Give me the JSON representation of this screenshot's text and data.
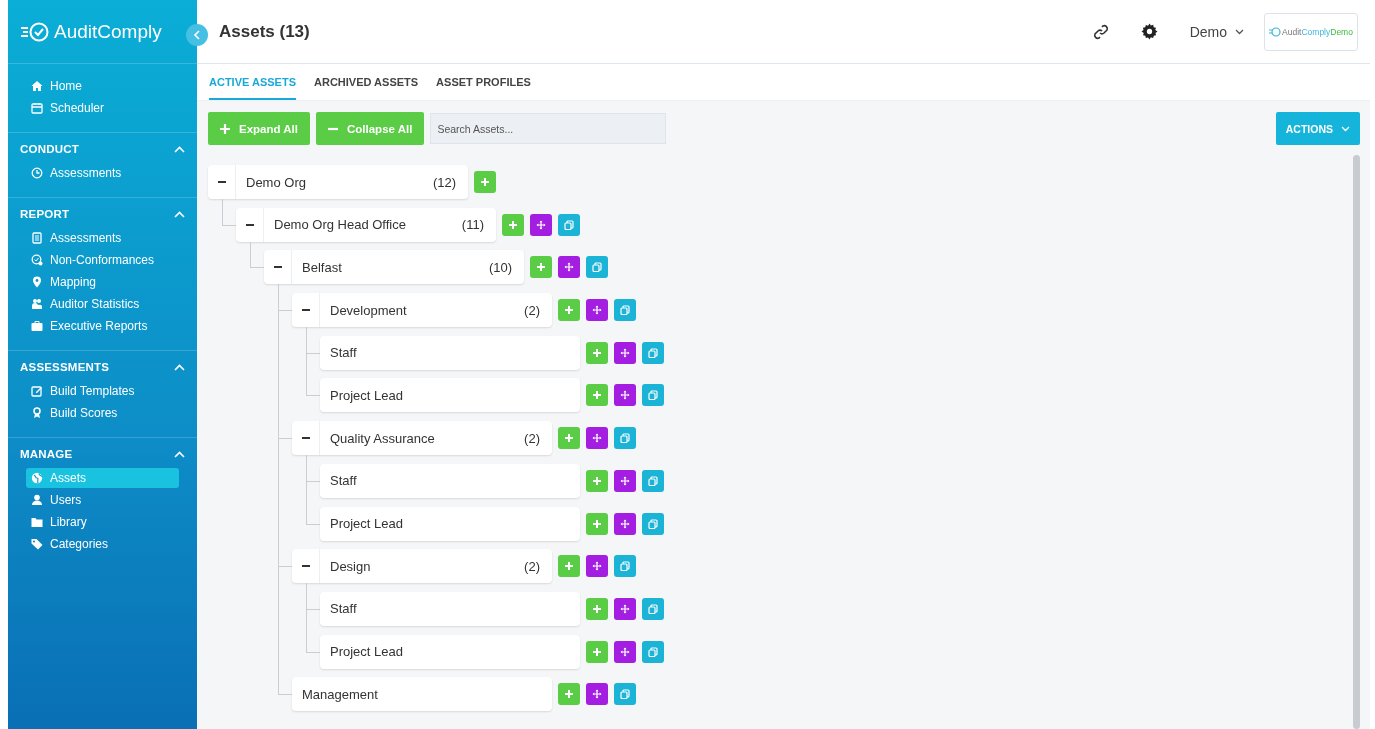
{
  "sidebar": {
    "logo": "AuditComply",
    "top_items": [
      {
        "label": "Home",
        "selected": false
      },
      {
        "label": "Scheduler",
        "selected": false
      }
    ],
    "sections": [
      {
        "title": "CONDUCT",
        "expanded": true,
        "items": [
          {
            "label": "Assessments",
            "selected": false
          }
        ]
      },
      {
        "title": "REPORT",
        "expanded": true,
        "items": [
          {
            "label": "Assessments",
            "selected": false
          },
          {
            "label": "Non-Conformances",
            "selected": false
          },
          {
            "label": "Mapping",
            "selected": false
          },
          {
            "label": "Auditor Statistics",
            "selected": false
          },
          {
            "label": "Executive Reports",
            "selected": false
          }
        ]
      },
      {
        "title": "ASSESSMENTS",
        "expanded": true,
        "items": [
          {
            "label": "Build Templates",
            "selected": false
          },
          {
            "label": "Build Scores",
            "selected": false
          }
        ]
      },
      {
        "title": "MANAGE",
        "expanded": true,
        "items": [
          {
            "label": "Assets",
            "selected": true
          },
          {
            "label": "Users",
            "selected": false
          },
          {
            "label": "Library",
            "selected": false
          },
          {
            "label": "Categories",
            "selected": false
          }
        ]
      }
    ]
  },
  "header": {
    "title": "Assets (13)",
    "user": "Demo",
    "company_logo": [
      "Audit",
      "Comply",
      "Demo"
    ]
  },
  "tabs": [
    {
      "label": "ACTIVE ASSETS",
      "selected": true
    },
    {
      "label": "ARCHIVED ASSETS",
      "selected": false
    },
    {
      "label": "ASSET PROFILES",
      "selected": false
    }
  ],
  "toolbar": {
    "expand_all": "Expand All",
    "collapse_all": "Collapse All",
    "search": {
      "placeholder": "Search Assets..."
    },
    "actions": "ACTIONS"
  },
  "tree": [
    {
      "name": "Demo Org",
      "count": "(12)",
      "expanded": true,
      "actions": [
        {
          "kind": "add"
        }
      ],
      "children": [
        {
          "name": "Demo Org Head Office",
          "count": "(11)",
          "expanded": true,
          "actions": [
            {
              "kind": "add"
            },
            {
              "kind": "move"
            },
            {
              "kind": "copy"
            }
          ],
          "children": [
            {
              "name": "Belfast",
              "count": "(10)",
              "expanded": true,
              "actions": [
                {
                  "kind": "add"
                },
                {
                  "kind": "move"
                },
                {
                  "kind": "copy"
                }
              ],
              "children": [
                {
                  "name": "Development",
                  "count": "(2)",
                  "expanded": true,
                  "actions": [
                    {
                      "kind": "add"
                    },
                    {
                      "kind": "move"
                    },
                    {
                      "kind": "copy"
                    }
                  ],
                  "children": [
                    {
                      "name": "Staff",
                      "actions": [
                        {
                          "kind": "add"
                        },
                        {
                          "kind": "move"
                        },
                        {
                          "kind": "copy"
                        }
                      ]
                    },
                    {
                      "name": "Project Lead",
                      "actions": [
                        {
                          "kind": "add"
                        },
                        {
                          "kind": "move"
                        },
                        {
                          "kind": "copy"
                        }
                      ]
                    }
                  ]
                },
                {
                  "name": "Quality Assurance",
                  "count": "(2)",
                  "expanded": true,
                  "actions": [
                    {
                      "kind": "add"
                    },
                    {
                      "kind": "move"
                    },
                    {
                      "kind": "copy"
                    }
                  ],
                  "children": [
                    {
                      "name": "Staff",
                      "actions": [
                        {
                          "kind": "add"
                        },
                        {
                          "kind": "move"
                        },
                        {
                          "kind": "copy"
                        }
                      ]
                    },
                    {
                      "name": "Project Lead",
                      "actions": [
                        {
                          "kind": "add"
                        },
                        {
                          "kind": "move"
                        },
                        {
                          "kind": "copy"
                        }
                      ]
                    }
                  ]
                },
                {
                  "name": "Design",
                  "count": "(2)",
                  "expanded": true,
                  "actions": [
                    {
                      "kind": "add"
                    },
                    {
                      "kind": "move"
                    },
                    {
                      "kind": "copy"
                    }
                  ],
                  "children": [
                    {
                      "name": "Staff",
                      "actions": [
                        {
                          "kind": "add"
                        },
                        {
                          "kind": "move"
                        },
                        {
                          "kind": "copy"
                        }
                      ]
                    },
                    {
                      "name": "Project Lead",
                      "actions": [
                        {
                          "kind": "add"
                        },
                        {
                          "kind": "move"
                        },
                        {
                          "kind": "copy"
                        }
                      ]
                    }
                  ]
                },
                {
                  "name": "Management",
                  "actions": [
                    {
                      "kind": "add"
                    },
                    {
                      "kind": "move"
                    },
                    {
                      "kind": "copy"
                    }
                  ]
                }
              ]
            }
          ]
        }
      ]
    }
  ]
}
